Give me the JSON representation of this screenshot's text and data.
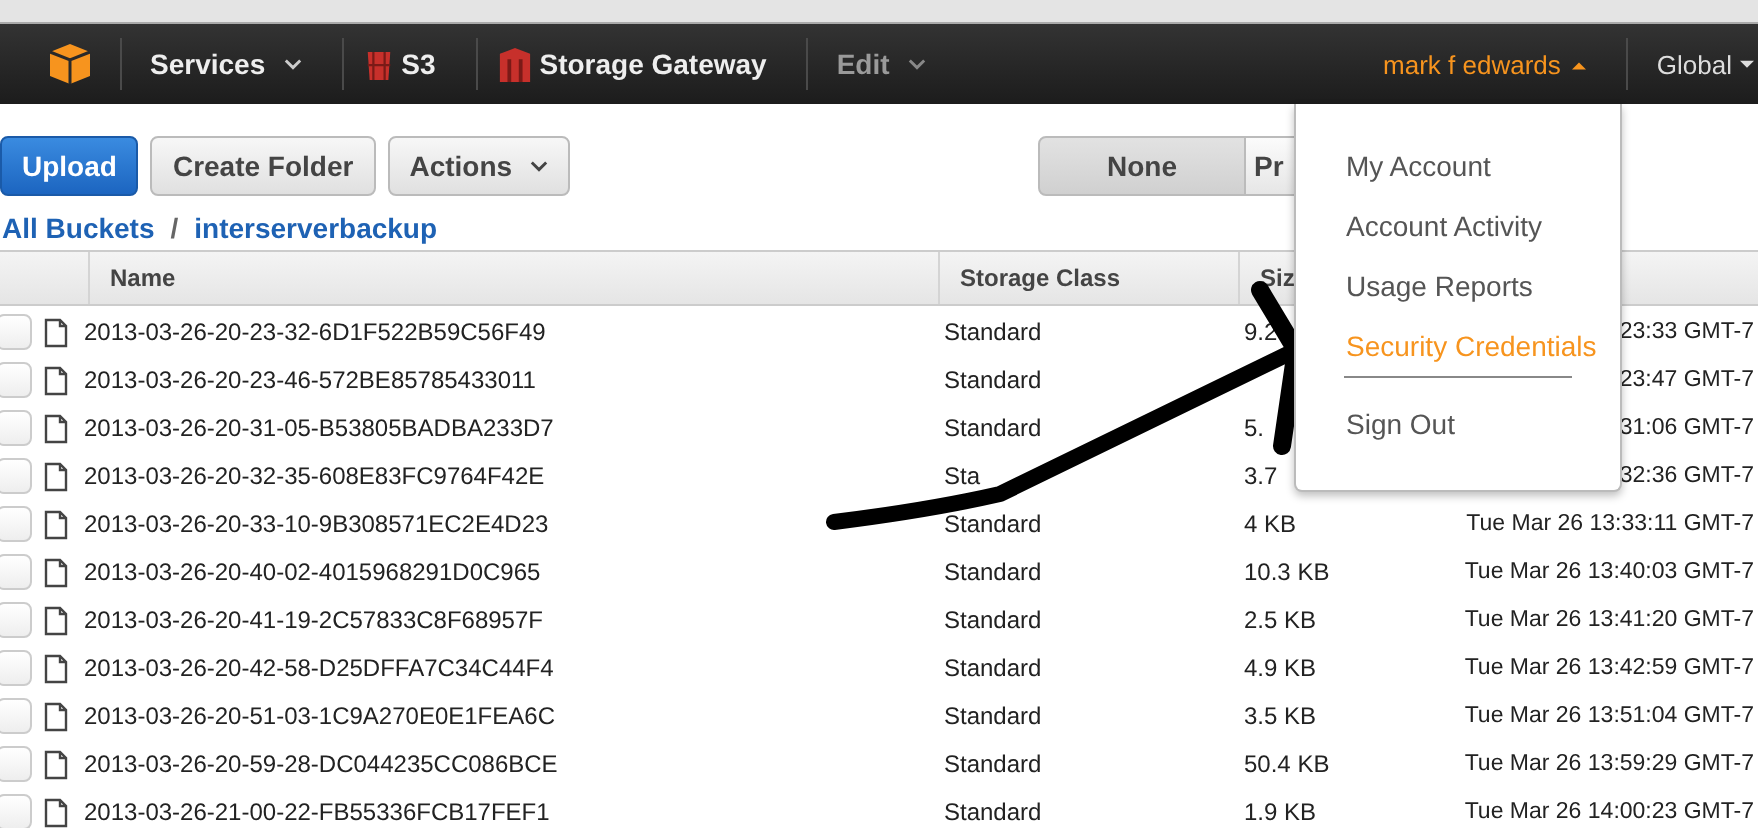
{
  "nav": {
    "services": "Services",
    "s3": "S3",
    "gateway": "Storage Gateway",
    "edit": "Edit",
    "user": "mark f edwards",
    "region": "Global"
  },
  "toolbar": {
    "upload": "Upload",
    "create_folder": "Create Folder",
    "actions": "Actions",
    "view_options": [
      {
        "label": "None",
        "selected": true
      },
      {
        "label": "Pr",
        "selected": false
      }
    ]
  },
  "breadcrumb": {
    "root": "All Buckets",
    "separator": "/",
    "bucket": "interserverbackup"
  },
  "table": {
    "columns": [
      "Name",
      "Storage Class",
      "Siz"
    ],
    "rows": [
      {
        "checked": false,
        "name": "2013-03-26-20-23-32-6D1F522B59C56F49",
        "storage_class": "Standard",
        "size": "9.2",
        "modified": "23:33 GMT-7"
      },
      {
        "checked": false,
        "name": "2013-03-26-20-23-46-572BE85785433011",
        "storage_class": "Standard",
        "modified": "23:47 GMT-7"
      },
      {
        "checked": false,
        "name": "2013-03-26-20-31-05-B53805BADBA233D7",
        "storage_class": "Standard",
        "size": "5.",
        "modified": "31:06 GMT-7"
      },
      {
        "checked": false,
        "name": "2013-03-26-20-32-35-608E83FC9764F42E",
        "storage_class": "Sta",
        "size": "3.7",
        "modified": "32:36 GMT-7"
      },
      {
        "checked": false,
        "name": "2013-03-26-20-33-10-9B308571EC2E4D23",
        "storage_class": "Standard",
        "size": "4 KB",
        "modified": "Tue Mar 26 13:33:11 GMT-7"
      },
      {
        "checked": false,
        "name": "2013-03-26-20-40-02-4015968291D0C965",
        "storage_class": "Standard",
        "size": "10.3 KB",
        "modified": "Tue Mar 26 13:40:03 GMT-7"
      },
      {
        "checked": false,
        "name": "2013-03-26-20-41-19-2C57833C8F68957F",
        "storage_class": "Standard",
        "size": "2.5 KB",
        "modified": "Tue Mar 26 13:41:20 GMT-7"
      },
      {
        "checked": false,
        "name": "2013-03-26-20-42-58-D25DFFA7C34C44F4",
        "storage_class": "Standard",
        "size": "4.9 KB",
        "modified": "Tue Mar 26 13:42:59 GMT-7"
      },
      {
        "checked": false,
        "name": "2013-03-26-20-51-03-1C9A270E0E1FEA6C",
        "storage_class": "Standard",
        "size": "3.5 KB",
        "modified": "Tue Mar 26 13:51:04 GMT-7"
      },
      {
        "checked": false,
        "name": "2013-03-26-20-59-28-DC044235CC086BCE",
        "storage_class": "Standard",
        "size": "50.4 KB",
        "modified": "Tue Mar 26 13:59:29 GMT-7"
      },
      {
        "checked": false,
        "name": "2013-03-26-21-00-22-FB55336FCB17FEF1",
        "storage_class": "Standard",
        "size": "1.9 KB",
        "modified": "Tue Mar 26 14:00:23 GMT-7"
      }
    ]
  },
  "account_menu": {
    "items": [
      {
        "label": "My Account",
        "selected": false
      },
      {
        "label": "Account Activity",
        "selected": false
      },
      {
        "label": "Usage Reports",
        "selected": false
      },
      {
        "label": "Security Credentials",
        "selected": true
      }
    ],
    "sign_out": "Sign Out"
  }
}
